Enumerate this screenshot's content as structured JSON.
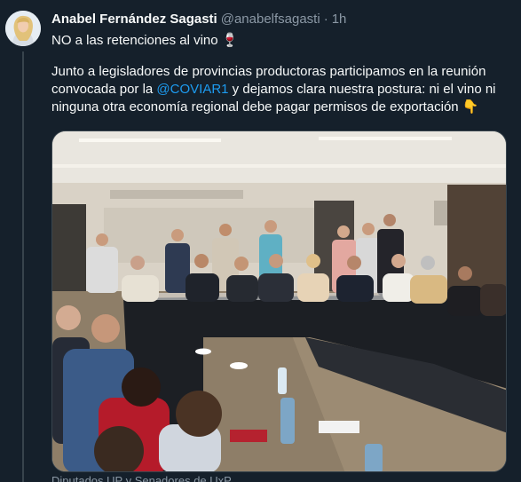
{
  "tweet": {
    "author_name": "Anabel Fernández Sagasti",
    "handle": "@anabelfsagasti",
    "separator": "·",
    "time": "1h",
    "line1": "NO a las retenciones al vino 🍷",
    "line2": "Junto a legisladores de provincias productoras participamos en la reunión",
    "line3_before": "convocada por la ",
    "mention": "@COVIAR1",
    "line3_after": " y dejamos clara nuestra postura: ni el vino ni",
    "line4": "ninguna otra economía regional debe pagar permisos de exportación 👇",
    "media_caption": "Diputados UP y Senadores de UxP"
  },
  "icons": {
    "avatar": "profile-photo",
    "media": "meeting-photo"
  },
  "colors": {
    "background": "#15202b",
    "text": "#f7f9f9",
    "secondary_text": "#8b98a5",
    "link": "#1d9bf0",
    "border": "#38444d"
  }
}
